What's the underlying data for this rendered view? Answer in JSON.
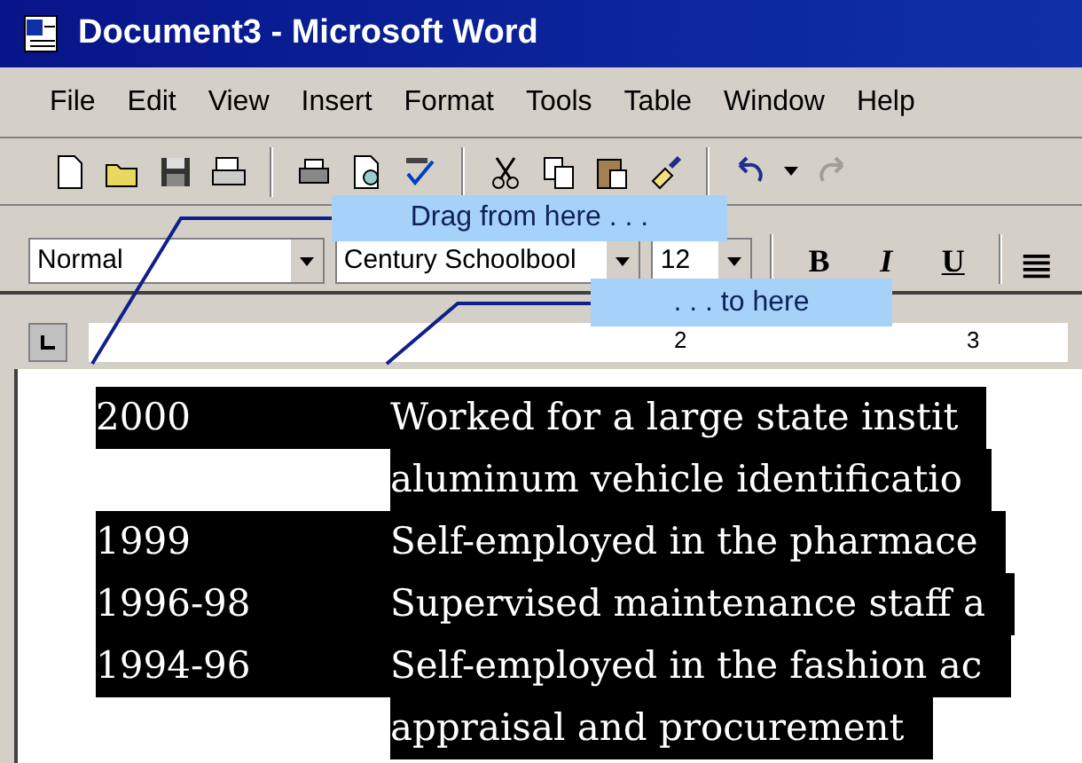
{
  "window": {
    "title": "Document3 - Microsoft Word"
  },
  "menu": [
    "File",
    "Edit",
    "View",
    "Insert",
    "Format",
    "Tools",
    "Table",
    "Window",
    "Help"
  ],
  "standard_toolbar": {
    "redo": {
      "disabled": true
    }
  },
  "formatting_toolbar": {
    "style": "Normal",
    "font": "Century Schoolbool",
    "size": "12",
    "buttons": [
      {
        "label": "B",
        "kind": "bold"
      },
      {
        "label": "I",
        "kind": "italic"
      },
      {
        "label": "U",
        "kind": "underline"
      }
    ]
  },
  "ruler": {
    "labels": [
      "2",
      "3"
    ]
  },
  "callouts": [
    {
      "text": "Drag from here . . ."
    },
    {
      "text": ". . . to here"
    }
  ],
  "document": {
    "rows": [
      {
        "year": "2000",
        "text": "Worked for a large state instit",
        "selected": true
      },
      {
        "text": "aluminum vehicle identificatio",
        "selected": true
      },
      {
        "year": "1999",
        "text": "Self-employed in the pharmace",
        "selected": true
      },
      {
        "year": "1996-98",
        "text": "Supervised maintenance staff a",
        "selected": true
      },
      {
        "year": "1994-96",
        "text": "Self-employed in the fashion ac",
        "selected": true
      },
      {
        "text": "appraisal and procurement",
        "selected": true
      }
    ]
  }
}
